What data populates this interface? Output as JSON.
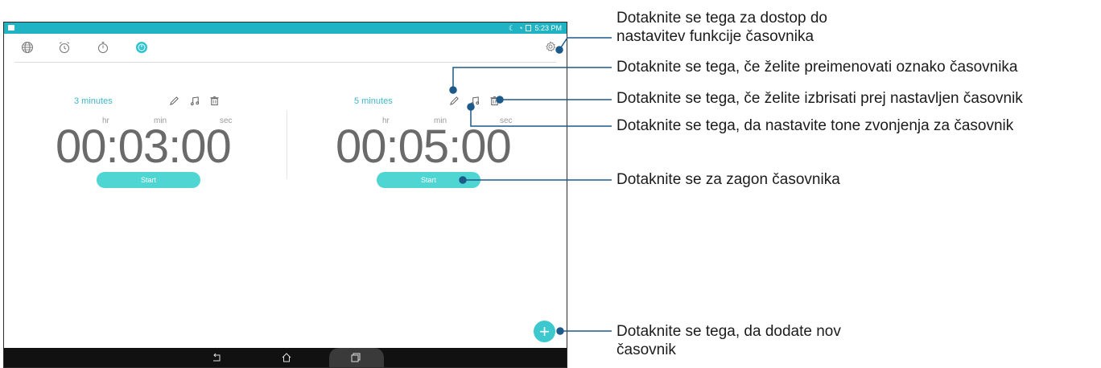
{
  "status_bar": {
    "time": "5:23 PM",
    "accent": "#1fb3c4"
  },
  "tabs": [
    {
      "name": "world-clock",
      "icon": "globe-icon"
    },
    {
      "name": "alarm",
      "icon": "alarm-clock-icon"
    },
    {
      "name": "stopwatch",
      "icon": "stopwatch-icon"
    },
    {
      "name": "timer",
      "icon": "timer-icon",
      "selected": true
    }
  ],
  "timers": [
    {
      "label": "3 minutes",
      "hr_label": "hr",
      "min_label": "min",
      "sec_label": "sec",
      "time": "00:03:00",
      "start_label": "Start"
    },
    {
      "label": "5 minutes",
      "hr_label": "hr",
      "min_label": "min",
      "sec_label": "sec",
      "time": "00:05:00",
      "start_label": "Start"
    }
  ],
  "fab": {
    "icon": "plus-icon",
    "label": "+"
  },
  "nav": [
    {
      "icon": "back-icon"
    },
    {
      "icon": "home-icon"
    },
    {
      "icon": "recents-icon"
    }
  ],
  "callouts": {
    "settings": "Dotaknite se tega za dostop do\nnastavitev funkcije časovnika",
    "rename": "Dotaknite se tega, če želite preimenovati oznako časovnika",
    "delete": "Dotaknite se tega, če želite izbrisati prej nastavljen časovnik",
    "ringtone": "Dotaknite se tega, da nastavite tone zvonjenja za časovnik",
    "start": "Dotaknite se za zagon časovnika",
    "add": "Dotaknite se tega, da dodate nov\nčasovnik"
  },
  "colors": {
    "accent": "#3cb8c8",
    "start_button": "#4fd6d2",
    "fab": "#3cc8cc",
    "callout_line": "#1c5a8a"
  }
}
